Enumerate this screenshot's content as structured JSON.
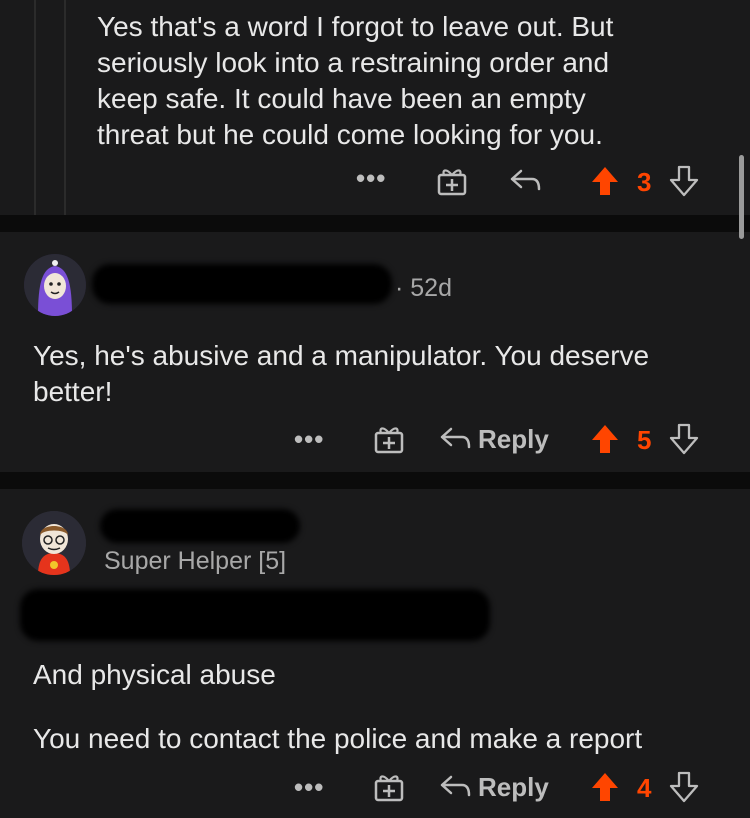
{
  "comments": [
    {
      "body_lines": [
        "Yes that's a word I forgot to leave out. But",
        "seriously look into a restraining order and",
        "keep safe. It could have been an empty",
        "threat but he could come looking for you."
      ],
      "more": "•••",
      "votes": "3"
    },
    {
      "age": "· 52d",
      "body_lines": [
        "Yes, he's abusive and a manipulator. You deserve",
        "better!"
      ],
      "more": "•••",
      "reply_label": "Reply",
      "votes": "5"
    },
    {
      "flair": "Super Helper [5]",
      "body_lines": [
        "And physical abuse",
        "You need to contact the police and make a report"
      ],
      "more": "•••",
      "reply_label": "Reply",
      "votes": "4"
    }
  ],
  "colors": {
    "upvote": "#ff4500",
    "background": "#0b0b0b",
    "card": "#1a1a1b",
    "text": "#e8e8e8",
    "muted": "#a8a8a8"
  },
  "icons": [
    "more-icon",
    "award-icon",
    "reply-icon",
    "upvote-icon",
    "downvote-icon"
  ]
}
